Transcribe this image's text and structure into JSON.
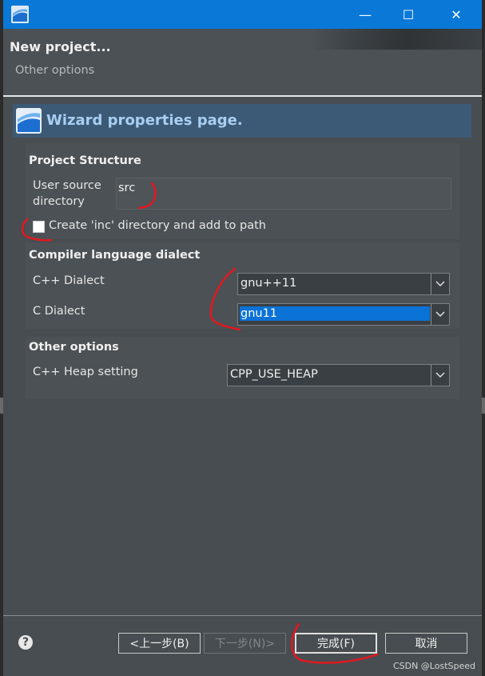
{
  "window": {
    "minimize_glyph": "—",
    "maximize_glyph": "☐",
    "close_glyph": "✕"
  },
  "banner": {
    "title": "New project...",
    "subtitle": "Other options"
  },
  "wizard": {
    "header": "Wizard properties page."
  },
  "project_structure": {
    "title": "Project Structure",
    "source_dir_label_line1": "User source",
    "source_dir_label_line2": "directory",
    "source_dir_value": "src",
    "inc_checkbox_label": "Create 'inc' directory and add to path",
    "inc_checked": false
  },
  "compiler_dialect": {
    "title": "Compiler language dialect",
    "cpp_label": "C++ Dialect",
    "cpp_value": "gnu++11",
    "c_label": "C Dialect",
    "c_value": "gnu11"
  },
  "other_options": {
    "title": "Other options",
    "heap_label": "C++ Heap setting",
    "heap_value": "CPP_USE_HEAP"
  },
  "footer": {
    "help_glyph": "?",
    "back_label": "<上一步(B)",
    "next_label": "下一步(N)>",
    "finish_label": "完成(F)",
    "cancel_label": "取消"
  },
  "watermark": "CSDN @LostSpeed",
  "colors": {
    "titlebar": "#0a78d7",
    "background": "#474d51",
    "wizard_header_bg": "#3c5a76",
    "wizard_header_text": "#a9cff3",
    "selection": "#0b72d6",
    "annotation": "#e3171f"
  }
}
